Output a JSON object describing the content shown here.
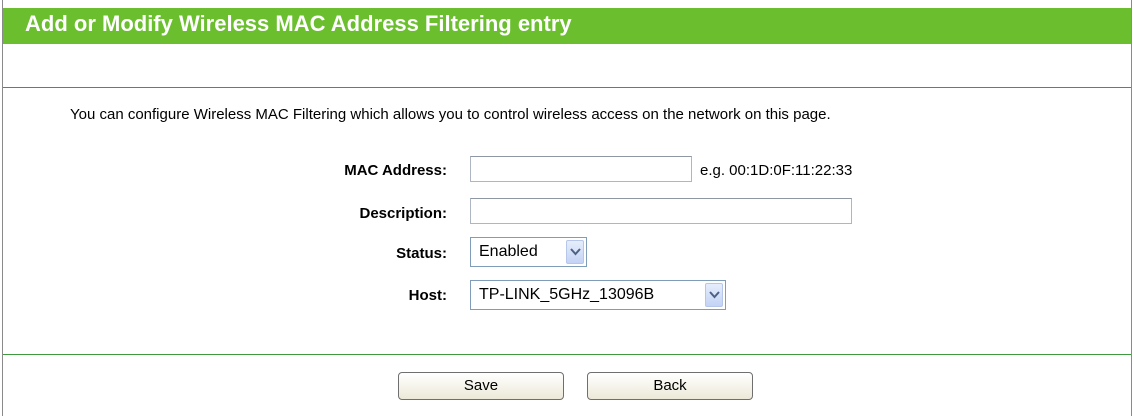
{
  "header": {
    "title": "Add or Modify Wireless MAC Address Filtering entry"
  },
  "intro_text": "You can configure Wireless MAC Filtering which allows you to control wireless access on the network on this page.",
  "form": {
    "mac_address": {
      "label": "MAC Address:",
      "value": "",
      "hint": "e.g. 00:1D:0F:11:22:33"
    },
    "description": {
      "label": "Description:",
      "value": ""
    },
    "status": {
      "label": "Status:",
      "selected": "Enabled"
    },
    "host": {
      "label": "Host:",
      "selected": "TP-LINK_5GHz_13096B"
    }
  },
  "buttons": {
    "save_label": "Save",
    "back_label": "Back"
  },
  "colors": {
    "title_bar": "#6bbf2f",
    "divider": "#3f9a3f"
  }
}
